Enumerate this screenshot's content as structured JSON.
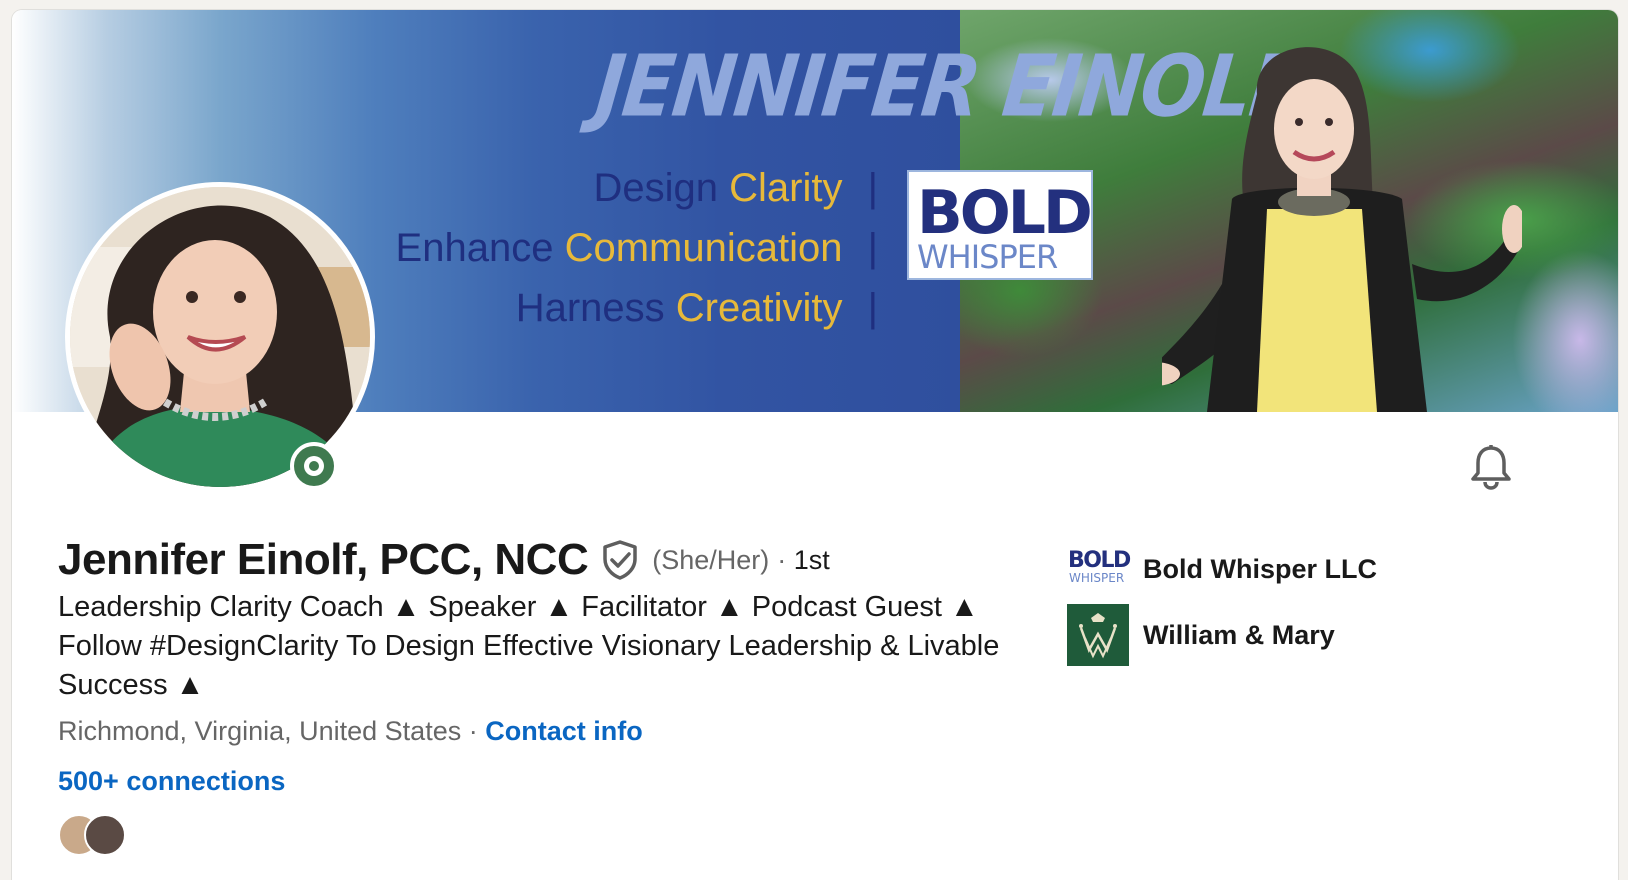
{
  "banner": {
    "title": "JENNIFER EINOLF",
    "taglines": [
      {
        "word": "Design",
        "highlight": "Clarity"
      },
      {
        "word": "Enhance",
        "highlight": "Communication"
      },
      {
        "word": "Harness",
        "highlight": "Creativity"
      }
    ],
    "separator": "|",
    "logo_top": "BOLD",
    "logo_bottom": "WHISPER",
    "colors": {
      "tagline": "#1f2f80",
      "highlight": "#e7b93a",
      "title": "#8fa8dc"
    }
  },
  "profile": {
    "name": "Jennifer Einolf, PCC, NCC",
    "pronouns": "(She/Her)",
    "degree_separator": "·",
    "degree": "1st",
    "headline": "Leadership Clarity Coach ▲ Speaker ▲ Facilitator ▲ Podcast Guest ▲ Follow #DesignClarity To Design Effective Visionary Leadership & Livable Success ▲",
    "location": "Richmond, Virginia, United States",
    "location_separator": "·",
    "contact_info_label": "Contact info",
    "connections_label": "500+ connections"
  },
  "experience": [
    {
      "name": "Bold Whisper LLC",
      "logo_icon": "bold-whisper-logo"
    },
    {
      "name": "William & Mary",
      "logo_icon": "william-mary-logo"
    }
  ],
  "icons": {
    "verified": "shield-check-icon",
    "notifications": "bell-icon",
    "open_to_work": "open-badge-icon"
  },
  "colors": {
    "link": "#0a66c2",
    "text": "#191919",
    "muted": "#666666",
    "open_badge": "#3f7a4f"
  }
}
